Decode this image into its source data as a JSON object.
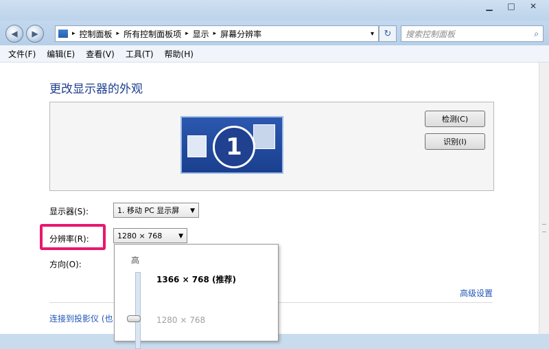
{
  "window": {
    "minimize_icon": "minimize-icon",
    "maximize_icon": "maximize-icon",
    "close_icon": "close-icon"
  },
  "address_bar": {
    "breadcrumb": [
      "控制面板",
      "所有控制面板项",
      "显示",
      "屏幕分辨率"
    ],
    "separator": "▸",
    "dropdown_arrow": "▾",
    "refresh_glyph": "↻"
  },
  "search": {
    "placeholder": "搜索控制面板"
  },
  "menu": [
    "文件(F)",
    "编辑(E)",
    "查看(V)",
    "工具(T)",
    "帮助(H)"
  ],
  "page": {
    "title": "更改显示器的外观",
    "monitor_number": "1",
    "detect_button": "检测(C)",
    "identify_button": "识别(I)",
    "display_label": "显示器(S):",
    "display_value": "1. 移动 PC 显示屏",
    "resolution_label": "分辨率(R):",
    "resolution_value": "1280 × 768",
    "orientation_label": "方向(O):",
    "advanced_link": "高级设置",
    "projector_link": "连接到投影仪 (也",
    "highlight_color": "#e8186d"
  },
  "resolution_dropdown": {
    "high_label": "高",
    "recommended": "1366 × 768 (推荐)",
    "current": "1280 × 768"
  }
}
